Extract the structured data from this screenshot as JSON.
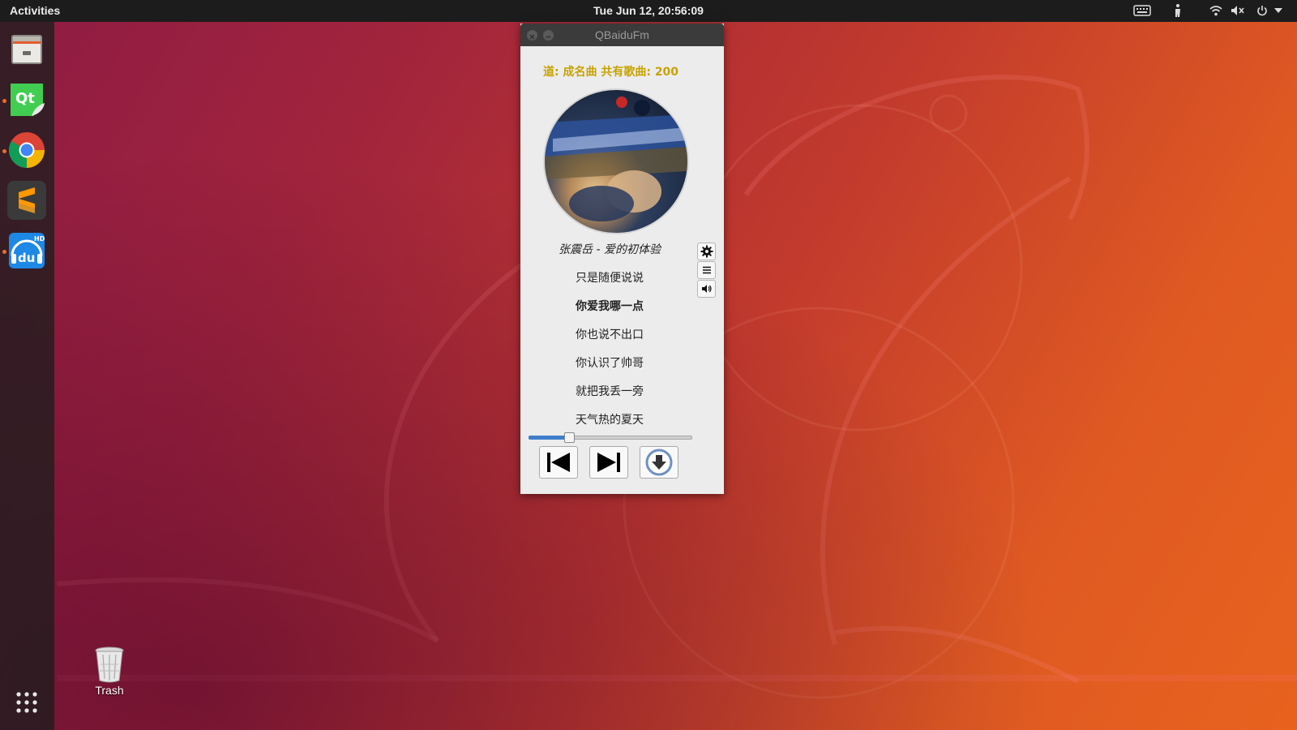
{
  "topbar": {
    "activities": "Activities",
    "clock": "Tue Jun 12, 20:56:09",
    "tray_icons": [
      "keyboard-icon",
      "screen-reader-icon",
      "wifi-icon",
      "volume-muted-icon",
      "power-icon",
      "chevron-down-icon"
    ]
  },
  "dock": {
    "items": [
      {
        "name": "files",
        "icon": "file-cabinet-icon"
      },
      {
        "name": "qt-creator",
        "icon": "qt-icon",
        "label": "Qt",
        "running": true
      },
      {
        "name": "chrome",
        "icon": "chrome-icon",
        "running": true
      },
      {
        "name": "sublime-text",
        "icon": "sublime-icon"
      },
      {
        "name": "baidu-fm",
        "icon": "baidu-du-icon",
        "label": "du",
        "badge": "HD",
        "running": true
      }
    ],
    "apps_grid": "show-apps-icon"
  },
  "window": {
    "title": "QBaiduFm",
    "channel_line": "道: 成名曲 共有歌曲: 200",
    "song_title": "张震岳 - 爱的初体验",
    "lyrics": [
      "只是随便说说",
      "你爱我哪一点",
      "你也说不出口",
      "你认识了帅哥",
      "就把我丢一旁",
      "天气热的夏天"
    ],
    "current_lyric_index": 1,
    "progress_fraction": 0.25,
    "side_icons": [
      "gear-icon",
      "menu-icon",
      "volume-icon"
    ],
    "controls": [
      "previous-track-icon",
      "next-track-icon",
      "download-icon"
    ]
  },
  "desktop": {
    "trash_label": "Trash"
  },
  "colors": {
    "channel_text": "#c7a200",
    "progress_fill": "#3f7ecb",
    "accent_orange": "#e95420"
  }
}
